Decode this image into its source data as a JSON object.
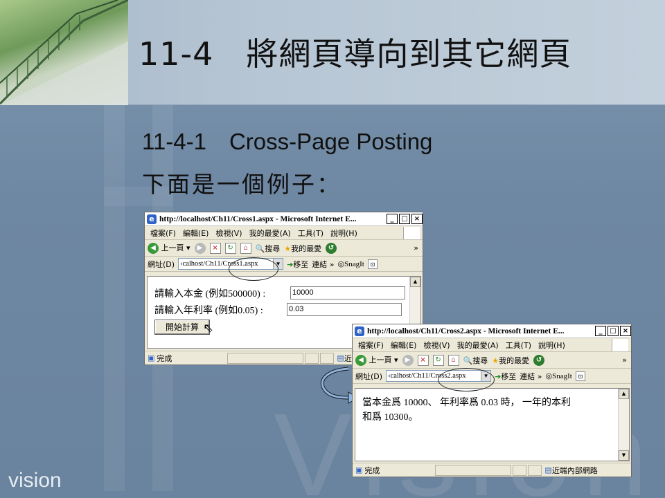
{
  "slide": {
    "title": "11-4　將網頁導向到其它網頁",
    "subtitle": "11-4-1　Cross-Page Posting",
    "intro": "下面是一個例子：",
    "brand": "vision"
  },
  "browser_menu": [
    "檔案(F)",
    "編輯(E)",
    "檢視(V)",
    "我的最愛(A)",
    "工具(T)",
    "說明(H)"
  ],
  "browser_toolbar": {
    "back": "上一頁",
    "search": "搜尋",
    "favorites": "我的最愛",
    "address_label": "網址(D)",
    "go": "移至",
    "links": "連結",
    "snagit": "SnagIt",
    "more": "»"
  },
  "window1": {
    "title": "http://localhost/Ch11/Cross1.aspx - Microsoft Internet E...",
    "address": "‹calhost/Ch11/Cross1.aspx",
    "principal_label": "請輸入本金 (例如500000) :",
    "principal_value": "10000",
    "rate_label": "請輸入年利率 (例如0.05) :",
    "rate_value": "0.03",
    "button_label": "開始計算",
    "status": "完成",
    "zone": "近端內"
  },
  "window2": {
    "title": "http://localhost/Ch11/Cross2.aspx - Microsoft Internet E...",
    "address": "‹calhost/Ch11/Cross2.aspx",
    "result_line1": "當本金爲 10000、 年利率爲 0.03 時， 一年的本利",
    "result_line2": "和爲 10300。",
    "status": "完成",
    "zone": "近端內部網路"
  }
}
